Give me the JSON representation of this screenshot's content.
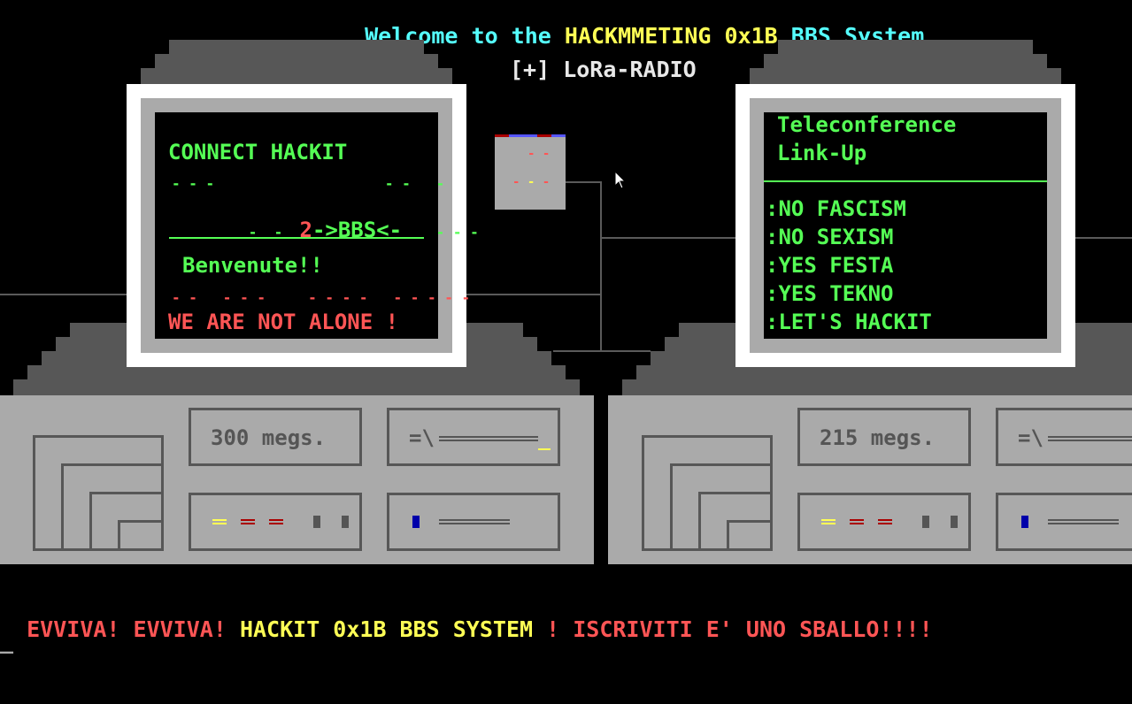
{
  "header": {
    "welcome_prefix": "Welcome to the ",
    "welcome_brand": "HACKMMETING 0x1B",
    "welcome_suffix": " BBS System"
  },
  "radio": {
    "label": "[+] LoRa-RADIO"
  },
  "left_screen": {
    "title": "CONNECT HACKIT",
    "bbs_prefix": "2",
    "bbs_label": "->BBS<-",
    "greeting": "Benvenute!!",
    "slogan": "WE ARE NOT ALONE !"
  },
  "right_screen": {
    "title_line1": "Teleconference",
    "title_line2": "Link-Up",
    "rules": [
      ":NO FASCISM",
      ":NO SEXISM",
      ":YES FESTA",
      ":YES TEKNO",
      ":LET'S HACKIT"
    ]
  },
  "left_unit": {
    "storage": "300 megs.",
    "slot_symbol": "=\\"
  },
  "right_unit": {
    "storage": "215 megs.",
    "slot_symbol": "=\\"
  },
  "ticker": {
    "part1": "EVVIVA! EVVIVA! ",
    "part2": "HACKIT 0x1B BBS SYSTEM",
    "part3": " ! ISCRIVITI E' UNO SBALLO!!!!"
  },
  "prompt": {
    "cursor": "_"
  },
  "colors": {
    "cyan": "#55ffff",
    "yellow": "#ffff55",
    "green": "#55ff55",
    "red": "#ff5555",
    "gray": "#aaaaaa",
    "dark_gray": "#575757",
    "blue": "#0000aa"
  }
}
